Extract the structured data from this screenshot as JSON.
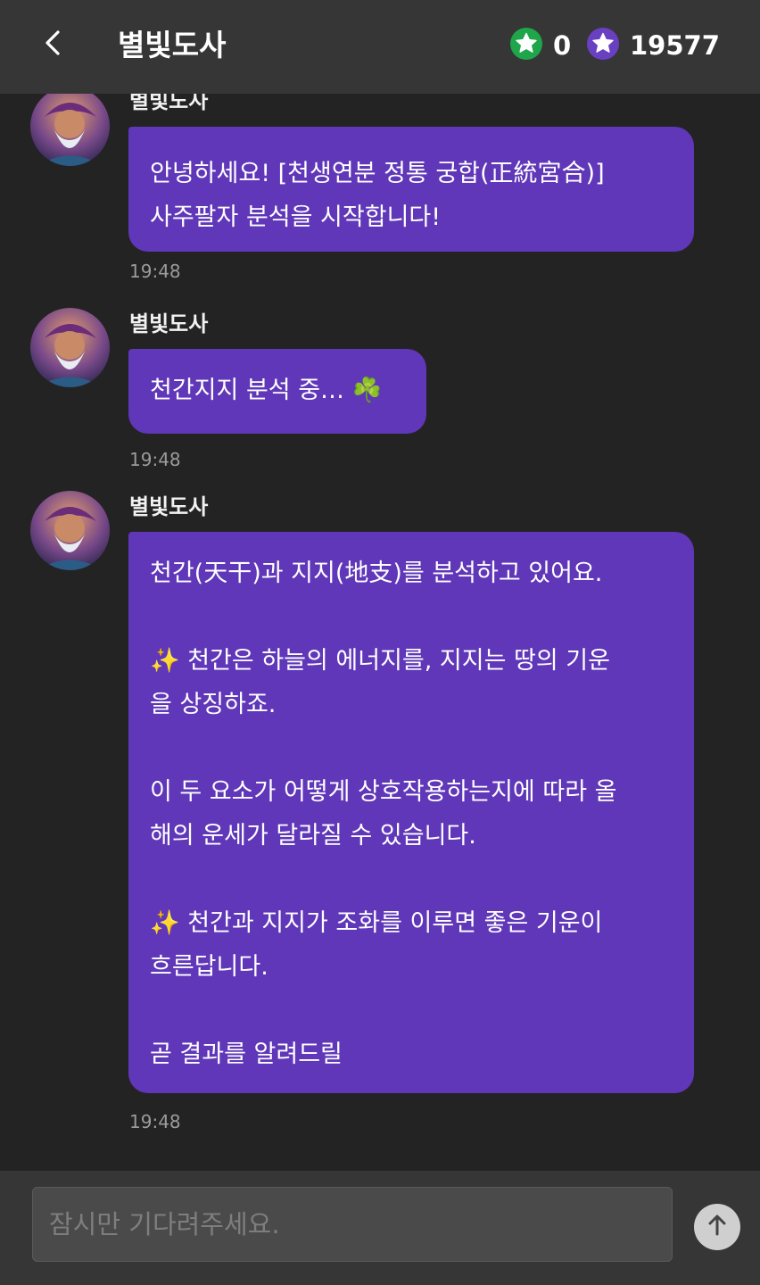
{
  "header": {
    "title": "별빛도사",
    "back_icon": "chevron-left-icon",
    "green_star_count": "0",
    "purple_star_count": "19577",
    "colors": {
      "bar": "#363636",
      "green": "#1fa64a",
      "purple": "#6a40c2"
    }
  },
  "messages": [
    {
      "sender": "별빛도사",
      "text": "안녕하세요! [천생연분 정통 궁합(正統宮合)]\n사주팔자 분석을 시작합니다!",
      "time": "19:48"
    },
    {
      "sender": "별빛도사",
      "text": "천간지지 분석 중… ☘️",
      "time": "19:48"
    },
    {
      "sender": "별빛도사",
      "text": "천간(天干)과 지지(地支)를 분석하고 있어요.\n\n✨ 천간은 하늘의 에너지를, 지지는 땅의 기운\n을 상징하죠.\n\n이 두 요소가 어떻게 상호작용하는지에 따라 올\n해의 운세가 달라질 수 있습니다.\n\n✨ 천간과 지지가 조화를 이루면 좋은 기운이\n흐른답니다.\n\n곧 결과를 알려드릴",
      "time": "19:48"
    }
  ],
  "input": {
    "placeholder": "잠시만 기다려주세요.",
    "value": ""
  },
  "send_icon": "arrow-up-icon",
  "colors": {
    "background": "#232323",
    "bubble": "#5f37b8"
  }
}
